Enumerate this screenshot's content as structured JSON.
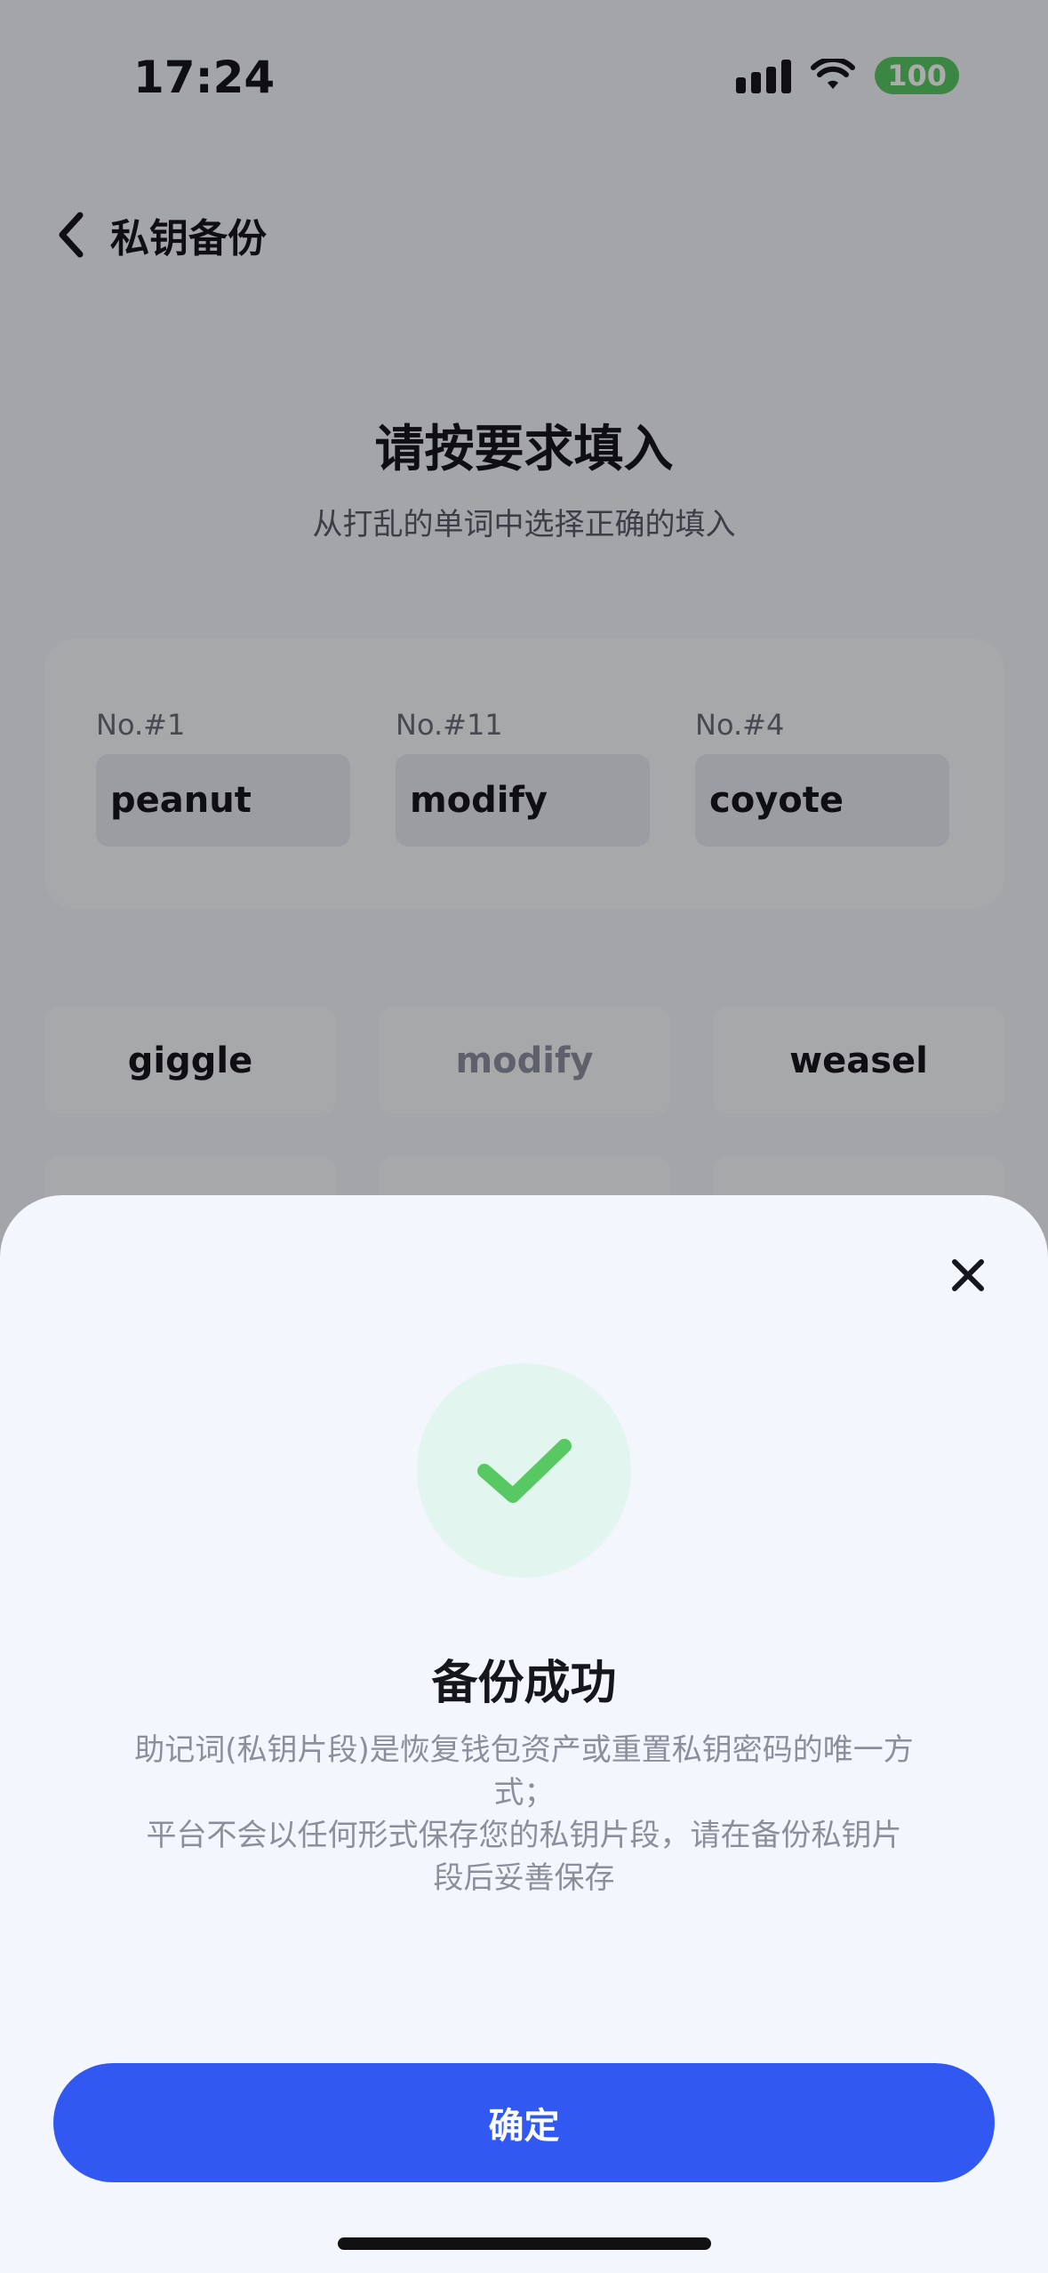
{
  "status_bar": {
    "time": "17:24",
    "battery": "100"
  },
  "header": {
    "title": "私钥备份",
    "back_icon": "chevron-left-icon"
  },
  "main": {
    "title": "请按要求填入",
    "subtitle": "从打乱的单词中选择正确的填入",
    "slots": [
      {
        "label": "No.#1",
        "value": "peanut"
      },
      {
        "label": "No.#11",
        "value": "modify"
      },
      {
        "label": "No.#4",
        "value": "coyote"
      }
    ],
    "word_options": [
      {
        "text": "giggle",
        "used": false
      },
      {
        "text": "modify",
        "used": true
      },
      {
        "text": "weasel",
        "used": false
      }
    ]
  },
  "modal": {
    "close_icon": "close-icon",
    "success_icon": "check-icon",
    "title": "备份成功",
    "description_line1": "助记词(私钥片段)是恢复钱包资产或重置私钥密码的唯一方式；",
    "description_line2": "平台不会以任何形式保存您的私钥片段，请在备份私钥片段后妥善保存",
    "confirm_label": "确定"
  },
  "colors": {
    "accent": "#3159f2",
    "success": "#58c863",
    "success_bg": "#e2f5ee"
  }
}
